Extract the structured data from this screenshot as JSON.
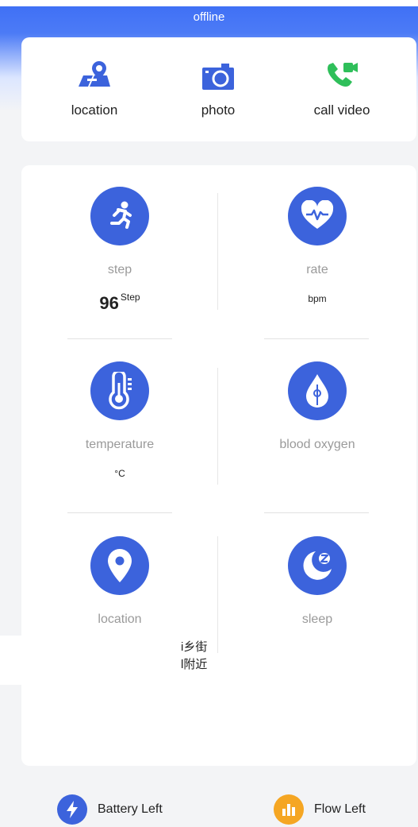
{
  "header": {
    "status": "offline"
  },
  "actions": [
    {
      "label": "location",
      "icon": "map-pin-icon"
    },
    {
      "label": "photo",
      "icon": "camera-icon"
    },
    {
      "label": "call video",
      "icon": "video-call-icon"
    }
  ],
  "metrics": {
    "step": {
      "label": "step",
      "value": "96",
      "unit": "Step"
    },
    "rate": {
      "label": "rate",
      "unit": "bpm"
    },
    "temperature": {
      "label": "temperature",
      "unit": "°C"
    },
    "blood_oxygen": {
      "label": "blood oxygen"
    },
    "location": {
      "label": "location",
      "address_line1": "i乡街",
      "address_line2": "l附近"
    },
    "sleep": {
      "label": "sleep"
    }
  },
  "footer": {
    "battery_label": "Battery Left",
    "flow_label": "Flow Left"
  },
  "colors": {
    "accent": "#3c63dc",
    "header": "#3d6ef5",
    "green": "#2fbf5a",
    "orange": "#f5a623"
  }
}
